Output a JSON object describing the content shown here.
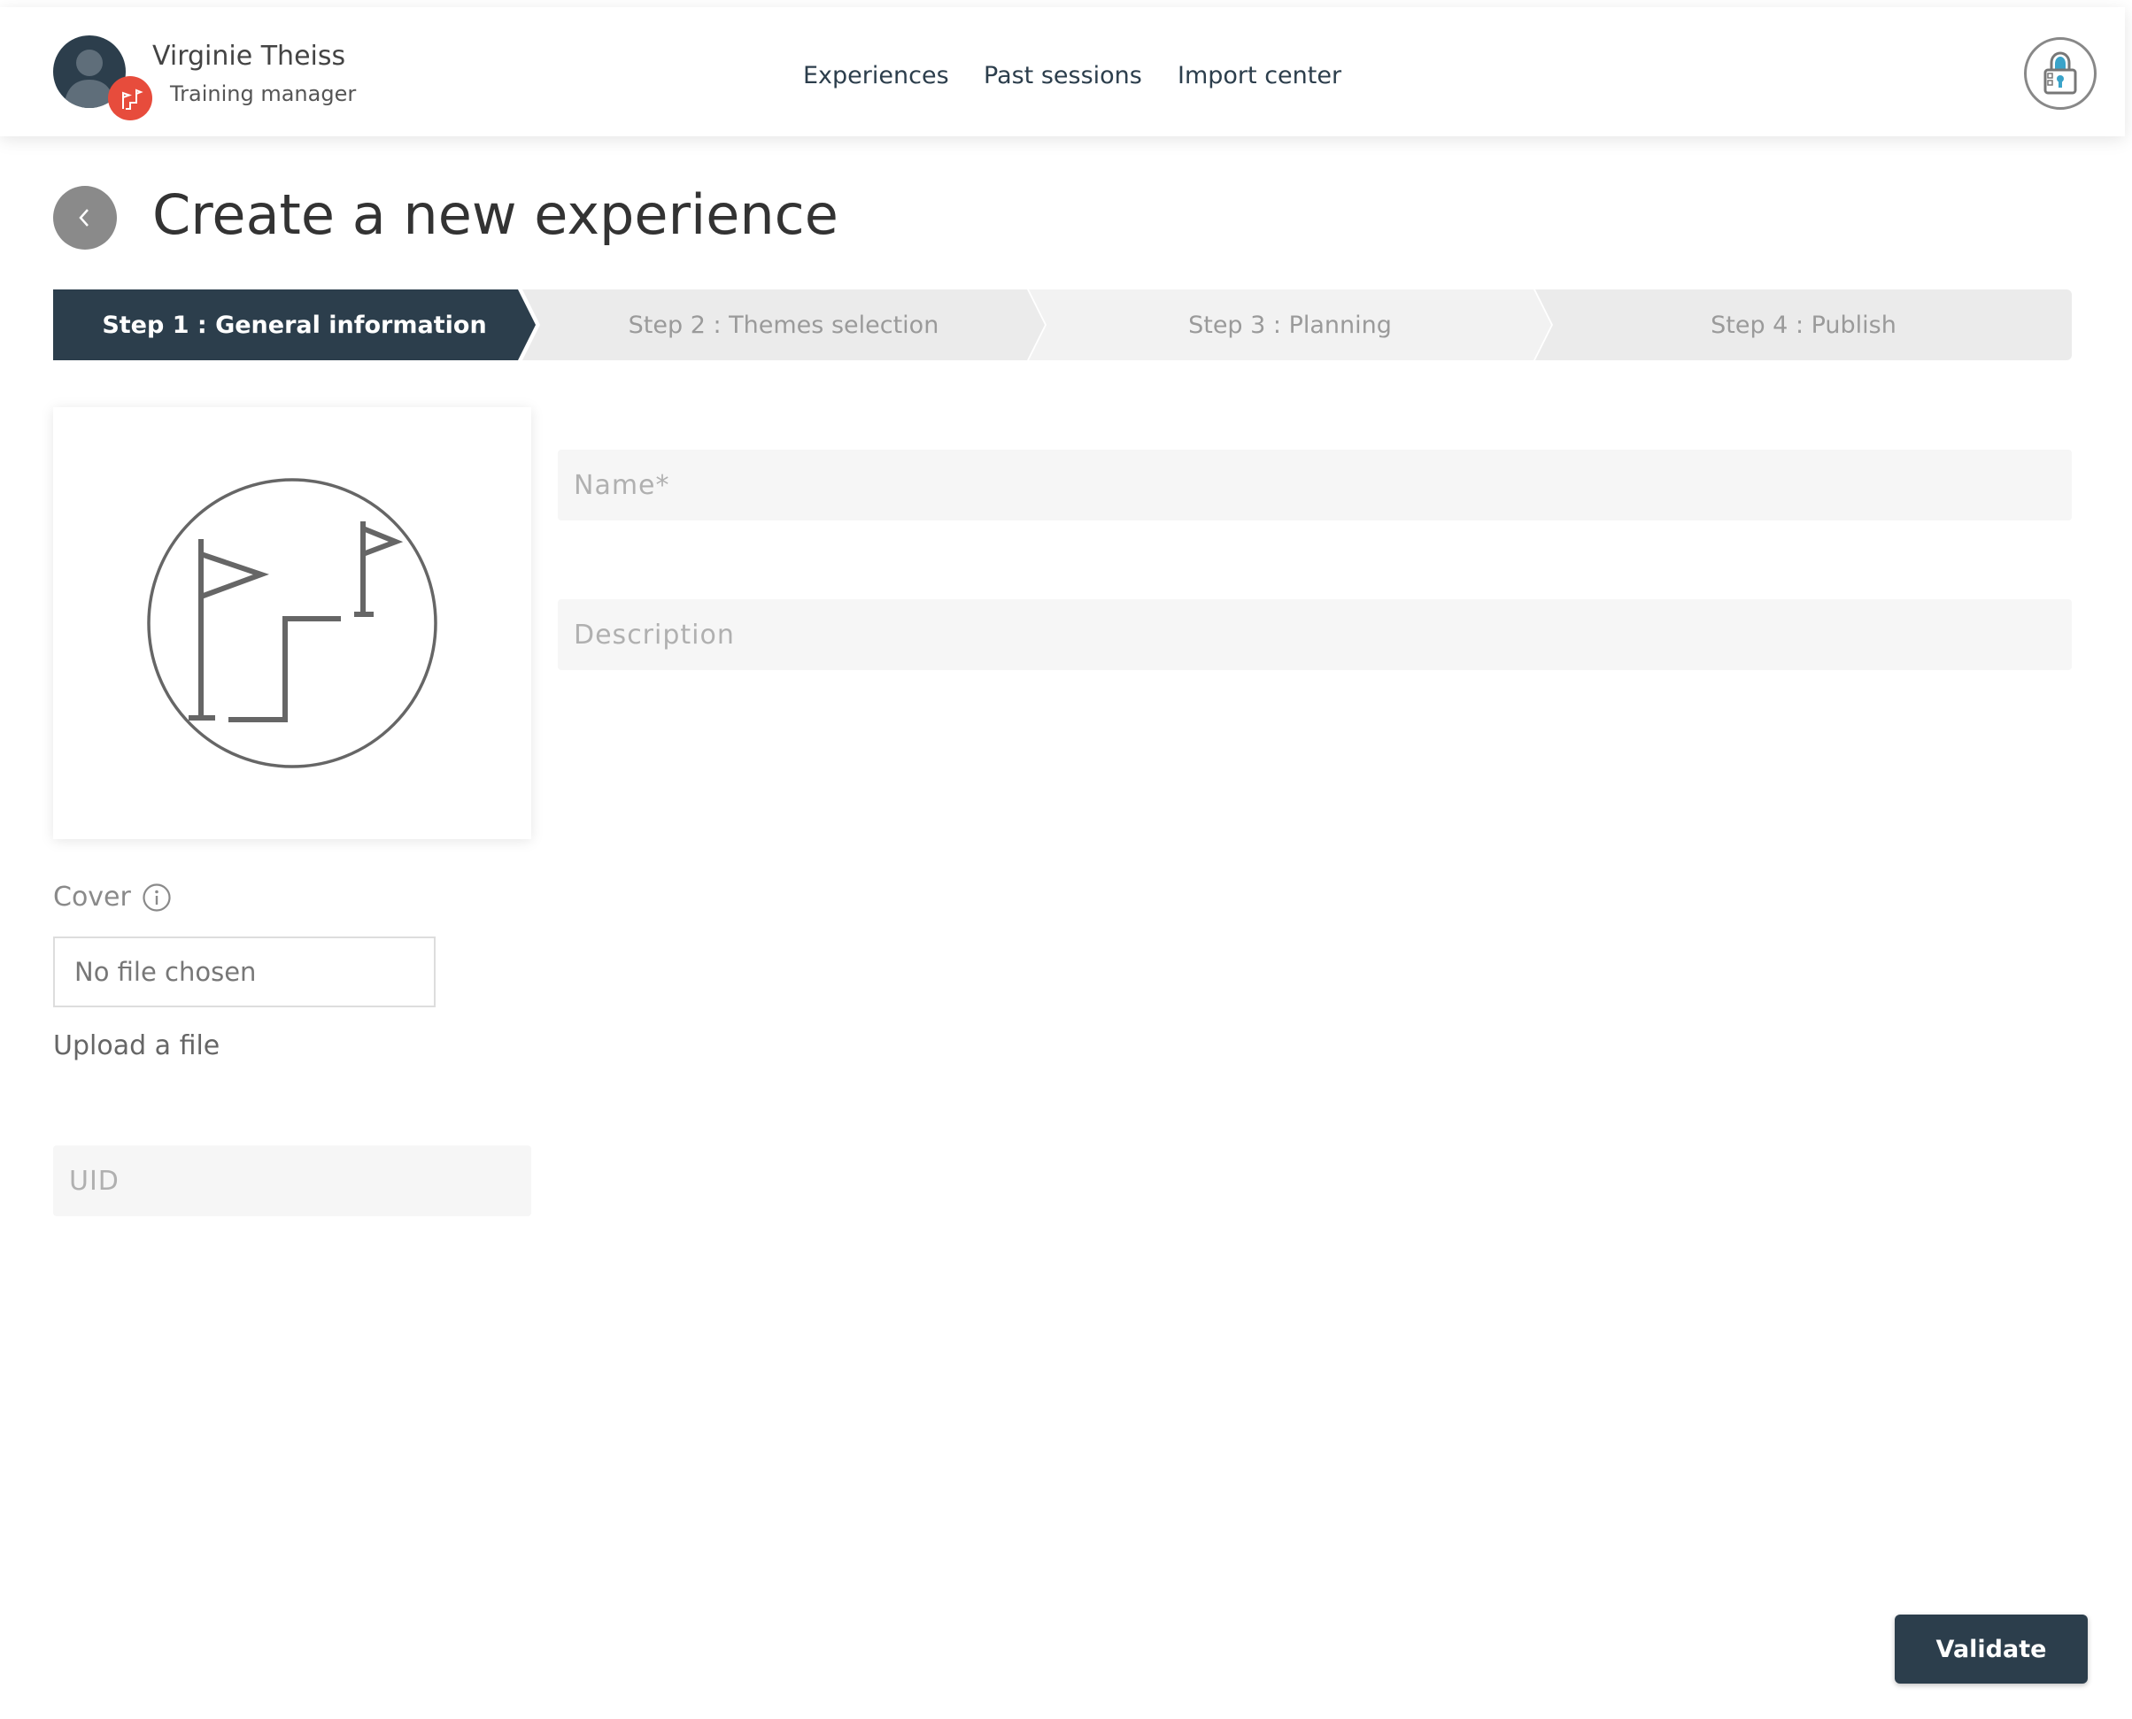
{
  "user": {
    "name": "Virginie Theiss",
    "role": "Training manager"
  },
  "nav": {
    "items": [
      "Experiences",
      "Past sessions",
      "Import center"
    ]
  },
  "page": {
    "title": "Create a new experience"
  },
  "stepper": {
    "steps": [
      "Step 1 : General information",
      "Step 2 : Themes selection",
      "Step 3 : Planning",
      "Step 4 : Publish"
    ],
    "active_index": 0
  },
  "form": {
    "name_placeholder": "Name*",
    "description_placeholder": "Description",
    "cover_label": "Cover",
    "file_status": "No file chosen",
    "upload_label": "Upload a file",
    "uid_placeholder": "UID"
  },
  "actions": {
    "validate_label": "Validate"
  },
  "colors": {
    "primary": "#2c3e4c",
    "badge": "#e74c3c",
    "inactive_step": "#ebebeb"
  },
  "icons": {
    "avatar": "user-silhouette-icon",
    "role_badge": "flags-icon",
    "account": "lock-icon",
    "back": "chevron-left-icon",
    "cover_placeholder": "flags-steps-icon",
    "info": "info-icon"
  }
}
